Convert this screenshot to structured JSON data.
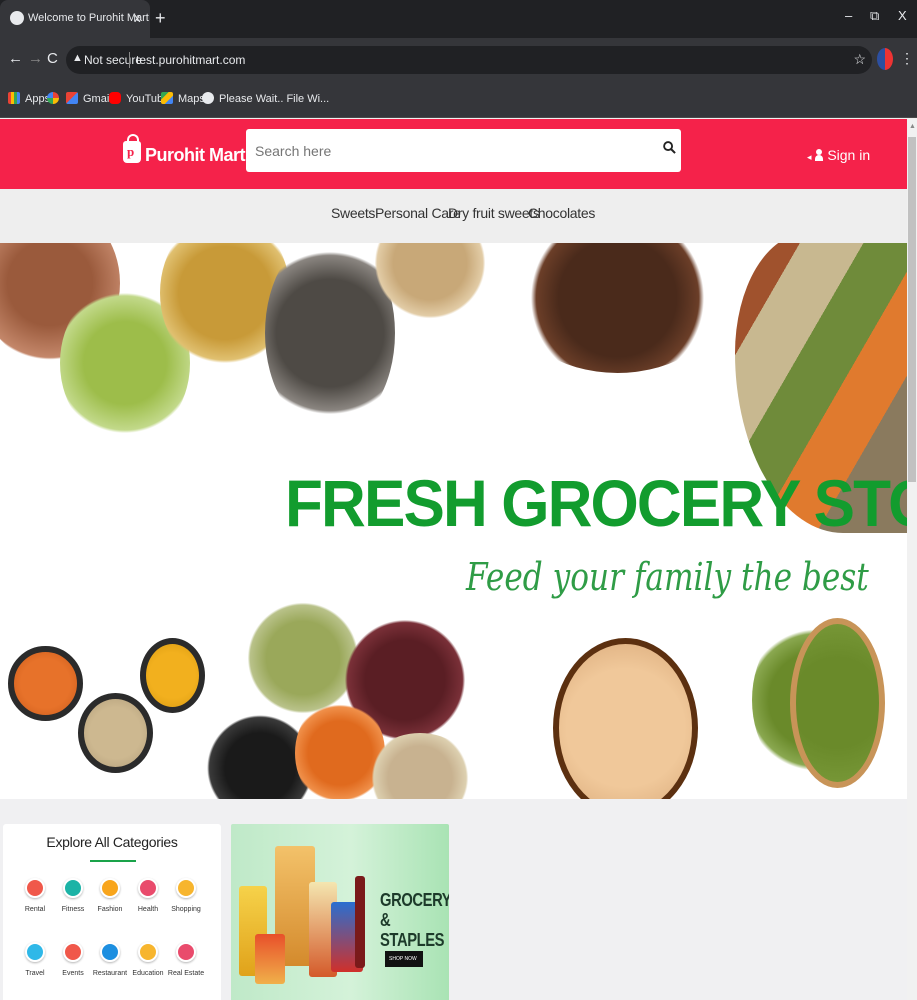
{
  "browser": {
    "tab_title": "Welcome to Purohit Mart",
    "tab_close": "x",
    "new_tab": "+",
    "window_controls": {
      "minimize": "–",
      "restore": "⧉",
      "close": "X"
    },
    "nav": {
      "back": "←",
      "forward": "→",
      "reload": "C"
    },
    "omnibox": {
      "security": "Not secure",
      "url": "test.purohitmart.com"
    },
    "bookmarks": [
      {
        "label": "Apps",
        "icon": "apps-grid-icon"
      },
      {
        "label": "",
        "icon": "google-icon"
      },
      {
        "label": "Gmail",
        "icon": "gmail-icon"
      },
      {
        "label": "YouTube",
        "icon": "youtube-icon"
      },
      {
        "label": "Maps",
        "icon": "maps-icon"
      },
      {
        "label": "Please Wait.. File Wi...",
        "icon": "globe-icon"
      }
    ]
  },
  "site": {
    "brand": "Purohit Mart",
    "brand_color": "#f5224a",
    "search_placeholder": "Search here",
    "signin": "Sign in",
    "categories_nav": [
      "Sweets",
      "Personal Care",
      "Dry fruit sweets",
      "Chocolates"
    ]
  },
  "banner": {
    "title": "FRESH GROCERY STORE",
    "subtitle": "Feed your family the best",
    "title_color": "#129c2e"
  },
  "explore": {
    "title": "Explore All Categories",
    "items": [
      {
        "label": "Rental",
        "color": "#f0584a"
      },
      {
        "label": "Fitness",
        "color": "#1bb3a6"
      },
      {
        "label": "Fashion",
        "color": "#f8a51c"
      },
      {
        "label": "Health",
        "color": "#e94b6c"
      },
      {
        "label": "Shopping",
        "color": "#f7b52e"
      },
      {
        "label": "Travel",
        "color": "#2fb8e8"
      },
      {
        "label": "Events",
        "color": "#f0584a"
      },
      {
        "label": "Restaurant",
        "color": "#1d8fe0"
      },
      {
        "label": "Education",
        "color": "#f7b52e"
      },
      {
        "label": "Real Estate",
        "color": "#e94b6c"
      }
    ]
  },
  "promo": {
    "title_line1": "GROCERY",
    "title_line2": "& STAPLES",
    "button": "SHOP NOW"
  }
}
